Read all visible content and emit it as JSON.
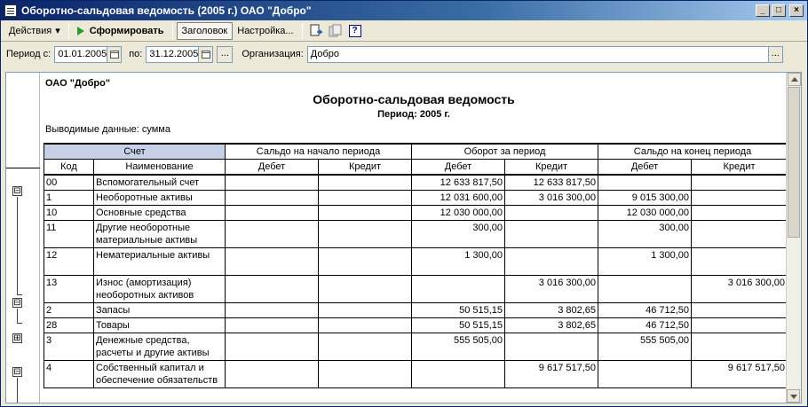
{
  "window": {
    "title": "Оборотно-сальдовая ведомость (2005 г.) ОАО \"Добро\"",
    "minimize": "_",
    "maximize": "□",
    "close": "×"
  },
  "toolbar": {
    "actions_label": "Действия",
    "actions_arrow": "▾",
    "generate_label": "Сформировать",
    "header_label": "Заголовок",
    "settings_label": "Настройка...",
    "help_label": "?"
  },
  "period": {
    "from_label": "Период с:",
    "from_value": "01.01.2005",
    "to_label": "по:",
    "to_value": "31.12.2005",
    "dots": "...",
    "org_label": "Организация:",
    "org_value": "Добро",
    "org_dots": "..."
  },
  "report": {
    "org_name": "ОАО \"Добро\"",
    "title": "Оборотно-сальдовая ведомость",
    "subtitle": "Период: 2005 г.",
    "data_label": "Выводимые данные: сумма",
    "header": {
      "account": "Счет",
      "opening": "Сальдо на начало периода",
      "turnover": "Оборот за период",
      "closing": "Сальдо на конец периода",
      "code": "Код",
      "name": "Наименование",
      "debit": "Дебет",
      "credit": "Кредит"
    },
    "rows": [
      {
        "code": "00",
        "name": "Вспомогательный счет",
        "od": "",
        "oc": "",
        "td": "12 633 817,50",
        "tc": "12 633 817,50",
        "cd": "",
        "cc": "",
        "tall": false
      },
      {
        "code": "1",
        "name": "Необоротные активы",
        "od": "",
        "oc": "",
        "td": "12 031 600,00",
        "tc": "3 016 300,00",
        "cd": "9 015 300,00",
        "cc": "",
        "tall": false
      },
      {
        "code": "10",
        "name": "Основные средства",
        "od": "",
        "oc": "",
        "td": "12 030 000,00",
        "tc": "",
        "cd": "12 030 000,00",
        "cc": "",
        "tall": false
      },
      {
        "code": "11",
        "name": "Другие необоротные материальные активы",
        "od": "",
        "oc": "",
        "td": "300,00",
        "tc": "",
        "cd": "300,00",
        "cc": "",
        "tall": true
      },
      {
        "code": "12",
        "name": "Нематериальные активы",
        "od": "",
        "oc": "",
        "td": "1 300,00",
        "tc": "",
        "cd": "1 300,00",
        "cc": "",
        "tall": true
      },
      {
        "code": "13",
        "name": "Износ (амортизация) необоротных активов",
        "od": "",
        "oc": "",
        "td": "",
        "tc": "3 016 300,00",
        "cd": "",
        "cc": "3 016 300,00",
        "tall": true
      },
      {
        "code": "2",
        "name": "Запасы",
        "od": "",
        "oc": "",
        "td": "50 515,15",
        "tc": "3 802,65",
        "cd": "46 712,50",
        "cc": "",
        "tall": false
      },
      {
        "code": "28",
        "name": "Товары",
        "od": "",
        "oc": "",
        "td": "50 515,15",
        "tc": "3 802,65",
        "cd": "46 712,50",
        "cc": "",
        "tall": false
      },
      {
        "code": "3",
        "name": "Денежные средства, расчеты и другие активы",
        "od": "",
        "oc": "",
        "td": "555 505,00",
        "tc": "",
        "cd": "555 505,00",
        "cc": "",
        "tall": true
      },
      {
        "code": "4",
        "name": "Собственный капитал и обеспечение обязательств",
        "od": "",
        "oc": "",
        "td": "",
        "tc": "9 617 517,50",
        "cd": "",
        "cc": "9 617 517,50",
        "tall": true
      }
    ]
  },
  "groups": [
    "⊟",
    "⊟",
    "⊞",
    "⊟"
  ]
}
